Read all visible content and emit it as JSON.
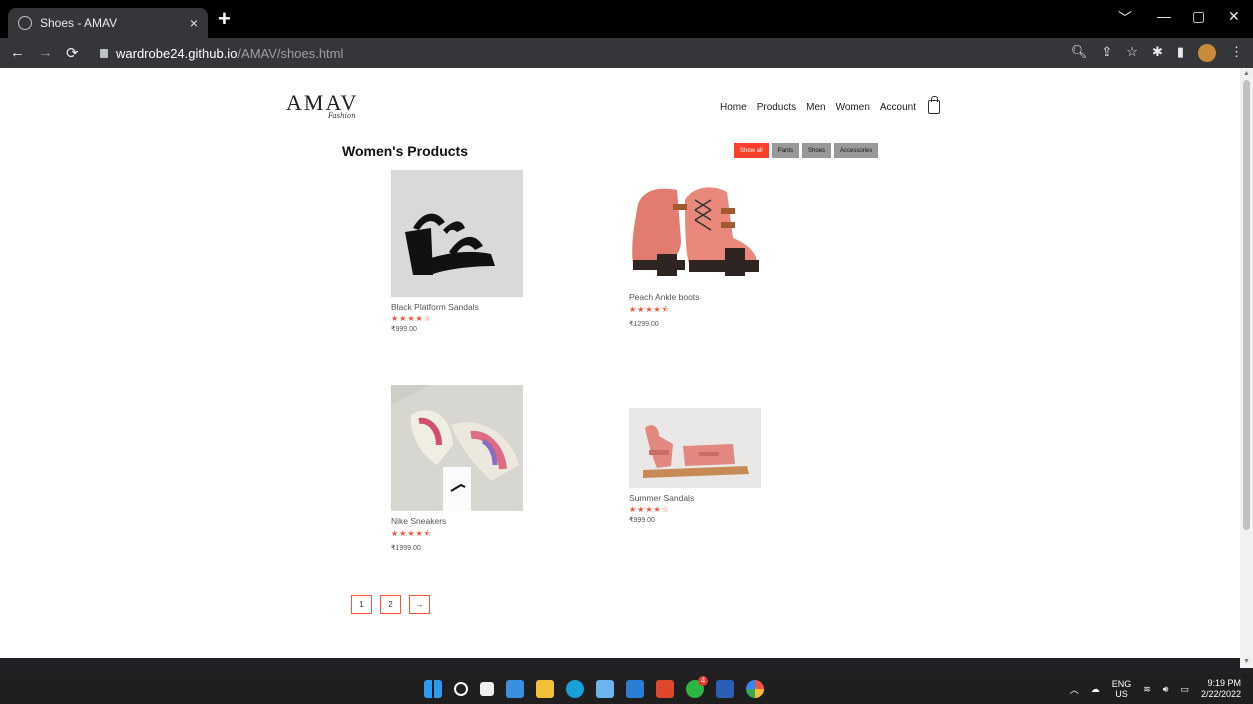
{
  "browser": {
    "tab_title": "Shoes - AMAV",
    "tab_close": "×",
    "new_tab": "+",
    "url_host": "wardrobe24.github.io",
    "url_path": "/AMAV/shoes.html",
    "window_controls": [
      "﹀",
      "—",
      "▢",
      "✕"
    ]
  },
  "site": {
    "logo": "AMAV",
    "logo_sub": "Fashion",
    "nav": [
      "Home",
      "Products",
      "Men",
      "Women",
      "Account"
    ]
  },
  "section": {
    "title": "Women's Products",
    "filters": [
      "Show all",
      "Pants",
      "Shoes",
      "Accessories"
    ],
    "active_filter": "Show all"
  },
  "products": [
    {
      "name": "Black Platform Sandals",
      "rating_stars": "★★★★☆",
      "rating": 4,
      "price": "₹999.00"
    },
    {
      "name": "Peach Ankle boots",
      "rating_stars": "★★★★⯪",
      "rating": 4.5,
      "price": "₹1299.00"
    },
    {
      "name": "Nike Sneakers",
      "rating_stars": "★★★★⯪",
      "rating": 4.5,
      "price": "₹1999.00"
    },
    {
      "name": "Summer Sandals",
      "rating_stars": "★★★★☆",
      "rating": 4,
      "price": "₹999.00"
    }
  ],
  "pagination": [
    "1",
    "2",
    "→"
  ],
  "taskbar": {
    "lang": "ENG",
    "region": "US",
    "time": "9:19 PM",
    "date": "2/22/2022",
    "whatsapp_badge": "4"
  },
  "colors": {
    "accent": "#ff523b",
    "active_filter": "#ff3f2a",
    "star": "#ff4c3b"
  }
}
